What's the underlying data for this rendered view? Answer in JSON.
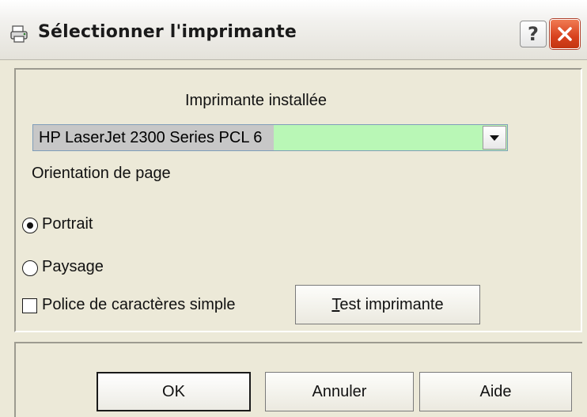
{
  "window": {
    "title": "Sélectionner l'imprimante",
    "help_button": "?",
    "close_icon": "close-icon"
  },
  "printer": {
    "label": "Imprimante installée",
    "selected": "HP LaserJet 2300 Series PCL 6",
    "highlight_color": "#b9f7b6"
  },
  "orientation": {
    "label": "Orientation de page",
    "options": [
      {
        "label": "Portrait",
        "selected": true
      },
      {
        "label": "Paysage",
        "selected": false
      }
    ]
  },
  "simple_font": {
    "label": "Police de caractères simple",
    "checked": false
  },
  "buttons": {
    "test": {
      "prefix": "T",
      "rest": "est imprimante"
    },
    "ok": "OK",
    "cancel": "Annuler",
    "help": "Aide"
  }
}
